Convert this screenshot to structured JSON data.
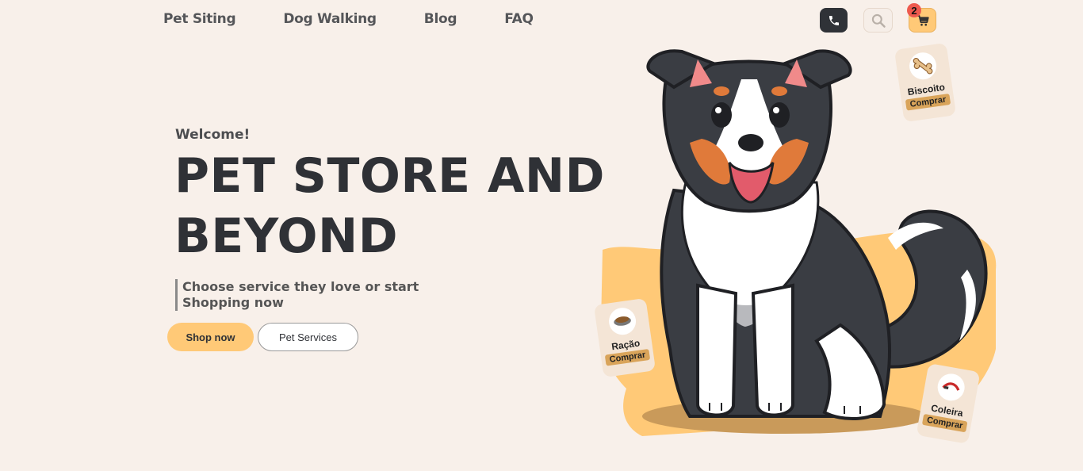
{
  "nav": {
    "items": [
      {
        "label": "Pet Siting"
      },
      {
        "label": "Dog Walking"
      },
      {
        "label": "Blog"
      },
      {
        "label": "FAQ"
      }
    ]
  },
  "header_icons": {
    "phone": "phone-icon",
    "search": "search-icon",
    "cart": "cart-icon",
    "cart_count": "2"
  },
  "hero": {
    "welcome": "Welcome!",
    "title": "PET STORE AND BEYOND",
    "tagline": "Choose service they love or start Shopping now",
    "primary_button": "Shop now",
    "secondary_button": "Pet Services"
  },
  "product_cards": [
    {
      "name": "Biscoito",
      "action": "Comprar",
      "icon": "bone-icon"
    },
    {
      "name": "Ração",
      "action": "Comprar",
      "icon": "food-bowl-icon"
    },
    {
      "name": "Coleira",
      "action": "Comprar",
      "icon": "collar-icon"
    }
  ],
  "colors": {
    "background": "#f8f0ea",
    "accent": "#ffc977",
    "dark": "#2f3136",
    "badge": "#ee5a4e"
  }
}
